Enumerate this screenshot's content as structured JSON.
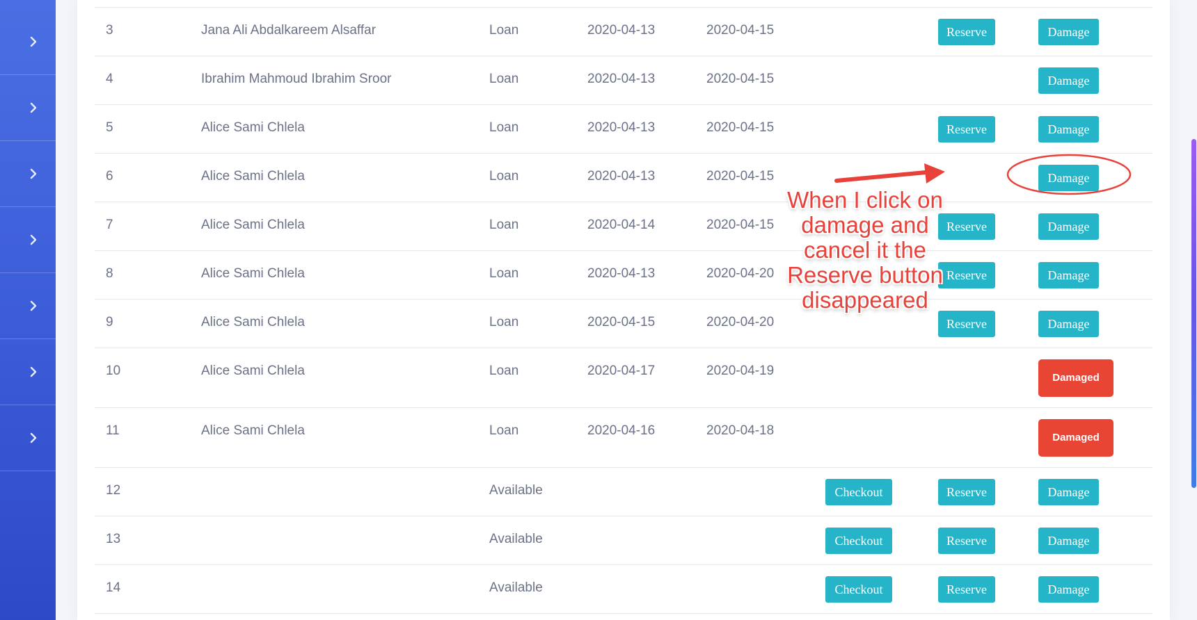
{
  "sidebar": {
    "items": 7,
    "icon": "chevron-right-icon"
  },
  "colors": {
    "info": "#26b4c9",
    "danger": "#e84535",
    "annotation": "#e8413a"
  },
  "rows": [
    {
      "num": "3",
      "name": "Jana Ali Abdalkareem Alsaffar",
      "status": "Loan",
      "start": "2020-04-13",
      "end": "2020-04-15",
      "checkout": "",
      "reserve": "Reserve",
      "damage": "Damage",
      "damaged": ""
    },
    {
      "num": "4",
      "name": "Ibrahim Mahmoud Ibrahim Sroor",
      "status": "Loan",
      "start": "2020-04-13",
      "end": "2020-04-15",
      "checkout": "",
      "reserve": "",
      "damage": "Damage",
      "damaged": ""
    },
    {
      "num": "5",
      "name": "Alice Sami Chlela",
      "status": "Loan",
      "start": "2020-04-13",
      "end": "2020-04-15",
      "checkout": "",
      "reserve": "Reserve",
      "damage": "Damage",
      "damaged": ""
    },
    {
      "num": "6",
      "name": "Alice Sami Chlela",
      "status": "Loan",
      "start": "2020-04-13",
      "end": "2020-04-15",
      "checkout": "",
      "reserve": "",
      "damage": "Damage",
      "damaged": ""
    },
    {
      "num": "7",
      "name": "Alice Sami Chlela",
      "status": "Loan",
      "start": "2020-04-14",
      "end": "2020-04-15",
      "checkout": "",
      "reserve": "Reserve",
      "damage": "Damage",
      "damaged": ""
    },
    {
      "num": "8",
      "name": "Alice Sami Chlela",
      "status": "Loan",
      "start": "2020-04-13",
      "end": "2020-04-20",
      "checkout": "",
      "reserve": "Reserve",
      "damage": "Damage",
      "damaged": ""
    },
    {
      "num": "9",
      "name": "Alice Sami Chlela",
      "status": "Loan",
      "start": "2020-04-15",
      "end": "2020-04-20",
      "checkout": "",
      "reserve": "Reserve",
      "damage": "Damage",
      "damaged": ""
    },
    {
      "num": "10",
      "name": "Alice Sami Chlela",
      "status": "Loan",
      "start": "2020-04-17",
      "end": "2020-04-19",
      "checkout": "",
      "reserve": "",
      "damage": "",
      "damaged": "Damaged"
    },
    {
      "num": "11",
      "name": "Alice Sami Chlela",
      "status": "Loan",
      "start": "2020-04-16",
      "end": "2020-04-18",
      "checkout": "",
      "reserve": "",
      "damage": "",
      "damaged": "Damaged"
    },
    {
      "num": "12",
      "name": "",
      "status": "Available",
      "start": "",
      "end": "",
      "checkout": "Checkout",
      "reserve": "Reserve",
      "damage": "Damage",
      "damaged": ""
    },
    {
      "num": "13",
      "name": "",
      "status": "Available",
      "start": "",
      "end": "",
      "checkout": "Checkout",
      "reserve": "Reserve",
      "damage": "Damage",
      "damaged": ""
    },
    {
      "num": "14",
      "name": "",
      "status": "Available",
      "start": "",
      "end": "",
      "checkout": "Checkout",
      "reserve": "Reserve",
      "damage": "Damage",
      "damaged": ""
    }
  ],
  "annotation": {
    "lines": [
      "When I click on",
      "damage and",
      "cancel it the",
      "Reserve button",
      "disappeared"
    ]
  }
}
